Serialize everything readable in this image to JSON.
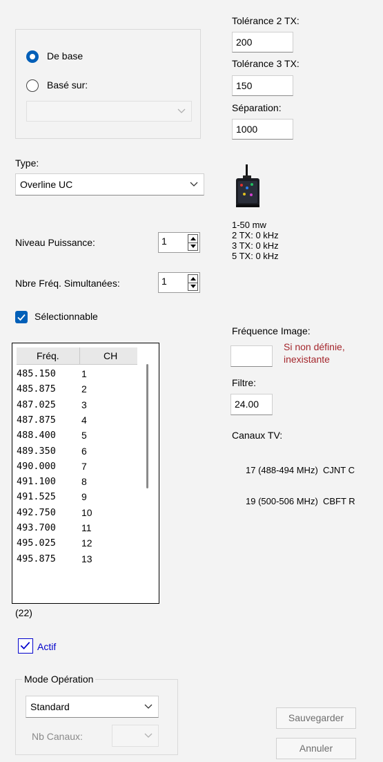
{
  "radio_group": {
    "option_base": "De base",
    "option_based_on": "Basé sur:",
    "based_on_select": ""
  },
  "type": {
    "label": "Type:",
    "value": "Overline UC"
  },
  "power_level": {
    "label": "Niveau Puissance:",
    "value": "1"
  },
  "simultaneous_freq": {
    "label": "Nbre Fréq. Simultanées:",
    "value": "1"
  },
  "selectable": {
    "label": "Sélectionnable",
    "checked": true
  },
  "freq_list": {
    "headers": [
      "Fréq.",
      "CH"
    ],
    "rows": [
      [
        "485.150",
        "1"
      ],
      [
        "485.875",
        "2"
      ],
      [
        "487.025",
        "3"
      ],
      [
        "487.875",
        "4"
      ],
      [
        "488.400",
        "5"
      ],
      [
        "489.350",
        "6"
      ],
      [
        "490.000",
        "7"
      ],
      [
        "491.100",
        "8"
      ],
      [
        "491.525",
        "9"
      ],
      [
        "492.750",
        "10"
      ],
      [
        "493.700",
        "11"
      ],
      [
        "495.025",
        "12"
      ],
      [
        "495.875",
        "13"
      ]
    ],
    "count": "(22)"
  },
  "active": {
    "label": "Actif",
    "checked": true
  },
  "mode": {
    "group_label": "Mode Opération",
    "value": "Standard",
    "nb_channels_label": "Nb Canaux:",
    "nb_channels_value": ""
  },
  "tolerance2": {
    "label": "Tolérance 2 TX:",
    "value": "200"
  },
  "tolerance3": {
    "label": "Tolérance 3 TX:",
    "value": "150"
  },
  "separation": {
    "label": "Séparation:",
    "value": "1000"
  },
  "device_info": {
    "power": "1-50 mw",
    "tx2": "2 TX: 0 kHz",
    "tx3": "3 TX: 0 kHz",
    "tx5": "5 TX: 0 kHz"
  },
  "image_freq": {
    "label": "Fréquence Image:",
    "value": "",
    "note_line1": "Si non définie,",
    "note_line2": "inexistante"
  },
  "filter": {
    "label": "Filtre:",
    "value": "24.00"
  },
  "tv_channels": {
    "label": "Canaux TV:",
    "lines": [
      "17 (488-494 MHz)  CJNT C",
      "19 (500-506 MHz)  CBFT R"
    ]
  },
  "buttons": {
    "save": "Sauvegarder",
    "cancel": "Annuler"
  },
  "colors": {
    "accent": "#005fb8",
    "note_red": "#a4262c",
    "active_blue": "#0000cc"
  }
}
